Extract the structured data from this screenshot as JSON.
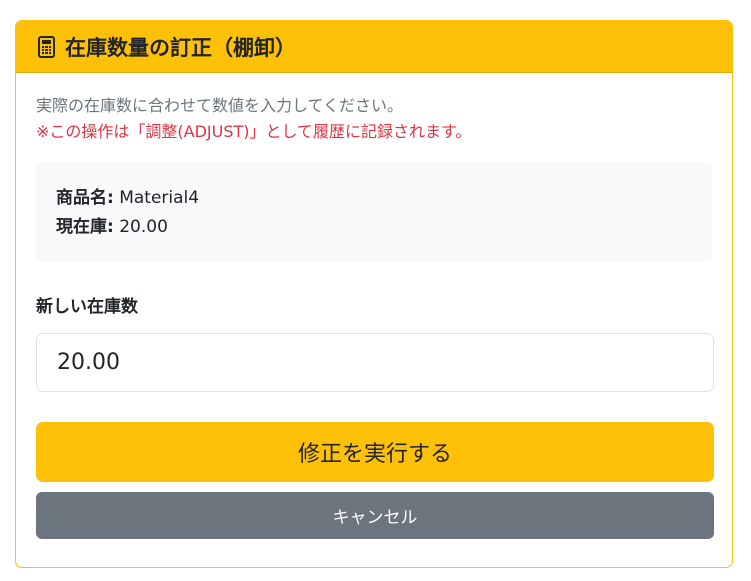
{
  "header": {
    "icon": "calculator-icon",
    "title": "在庫数量の訂正（棚卸）",
    "color": "#ffc107"
  },
  "body": {
    "description": "実際の在庫数に合わせて数値を入力してください。",
    "warning": "※この操作は「調整(ADJUST)」として履歴に記録されます。",
    "warning_color": "#dc3545"
  },
  "info": {
    "product_label": "商品名:",
    "product_value": "Material4",
    "stock_label": "現在庫:",
    "stock_value": "20.00"
  },
  "form": {
    "quantity_label": "新しい在庫数",
    "quantity_value": "20.00"
  },
  "actions": {
    "submit_label": "修正を実行する",
    "cancel_label": "キャンセル",
    "cancel_color": "#6c757d"
  }
}
